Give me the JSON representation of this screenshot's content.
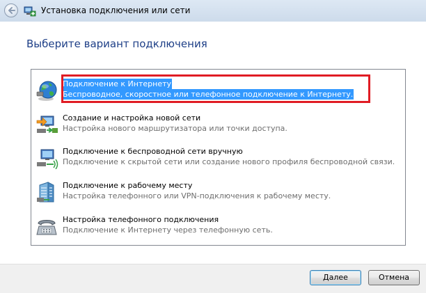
{
  "window": {
    "title": "Установка подключения или сети"
  },
  "main": {
    "heading": "Выберите вариант подключения",
    "options": [
      {
        "title": "Подключение к Интернету",
        "description": "Беспроводное, скоростное или телефонное подключение к Интернету.",
        "icon": "globe-icon",
        "selected": true
      },
      {
        "title": "Создание и настройка новой сети",
        "description": "Настройка нового маршрутизатора или точки доступа.",
        "icon": "network-setup-icon",
        "selected": false
      },
      {
        "title": "Подключение к беспроводной сети вручную",
        "description": "Подключение к скрытой сети или создание нового профиля беспроводной связи.",
        "icon": "wireless-network-icon",
        "selected": false
      },
      {
        "title": "Подключение к рабочему месту",
        "description": "Настройка телефонного или VPN-подключения к рабочему месту.",
        "icon": "workplace-building-icon",
        "selected": false
      },
      {
        "title": "Настройка телефонного подключения",
        "description": "Подключение к Интернету через телефонную сеть.",
        "icon": "dialup-phone-icon",
        "selected": false
      }
    ]
  },
  "footer": {
    "next_label": "Далее",
    "cancel_label": "Отмена"
  },
  "colors": {
    "selection": "#3399ff",
    "highlight_frame": "#e01c24",
    "heading": "#1e3f87"
  }
}
